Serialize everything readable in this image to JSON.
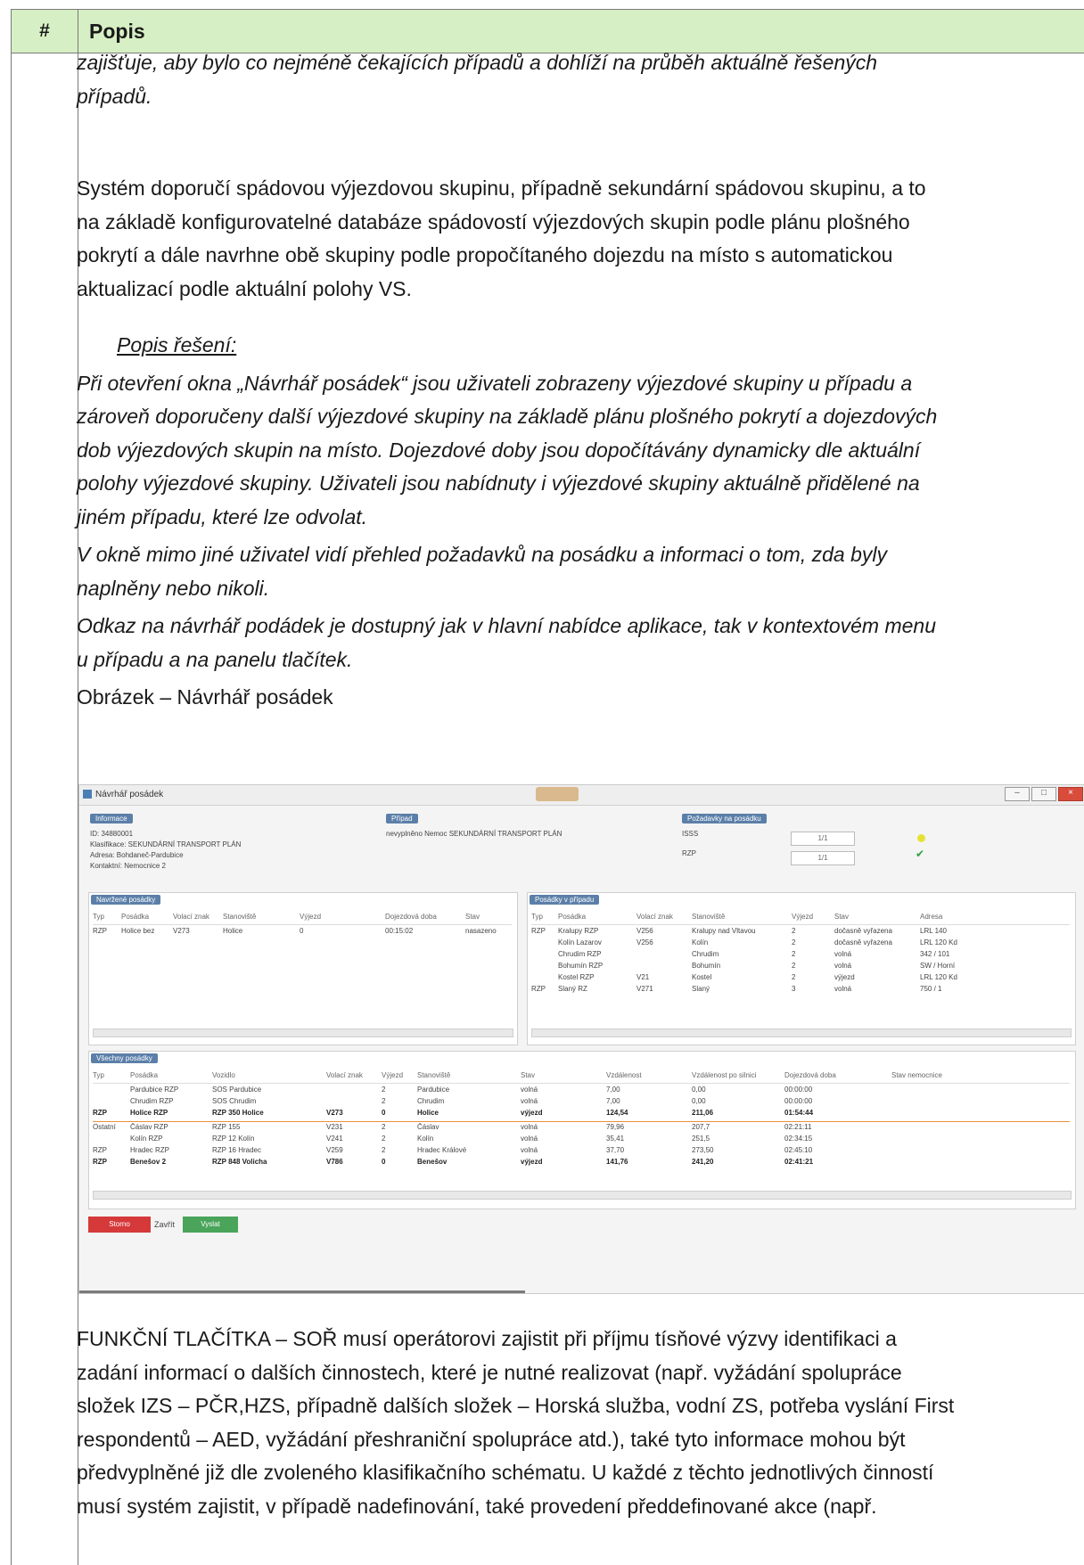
{
  "table": {
    "header_num": "#",
    "header_title": "Popis"
  },
  "paragraphs": {
    "p1_l1": "zajišťuje, aby bylo co nejméně čekajících případů a dohlíží na průběh aktuálně řešených",
    "p1_l2": "případů.",
    "p2_l1": "Systém doporučí spádovou výjezdovou skupinu, případně sekundární spádovou skupinu, a to",
    "p2_l2": "na základě konfigurovatelné databáze spádovostí výjezdových skupin podle plánu plošného",
    "p2_l3": "pokrytí a dále navrhne obě skupiny podle propočítaného dojezdu na místo s automatickou",
    "p2_l4": "aktualizací podle aktuální polohy VS.",
    "sub_heading": "Popis řešení:",
    "p3_l1": "Při otevření okna „Návrhář posádek“ jsou uživateli zobrazeny výjezdové skupiny u případu a",
    "p3_l2": "zároveň doporučeny další výjezdové skupiny na základě plánu plošného pokrytí a dojezdových",
    "p3_l3": "dob výjezdových skupin na místo. Dojezdové doby jsou dopočítávány dynamicky dle aktuální",
    "p3_l4": "polohy výjezdové skupiny. Uživateli jsou nabídnuty i výjezdové skupiny aktuálně přidělené na",
    "p3_l5": "jiném případu, které lze odvolat.",
    "p4_l1": "V okně mimo jiné uživatel vidí přehled požadavků na posádku a informaci o tom, zda byly",
    "p4_l2": "naplněny nebo nikoli.",
    "p5_l1": "Odkaz na návrhář podádek je dostupný jak v hlavní nabídce aplikace, tak v kontextovém menu",
    "p5_l2": "u případu a na panelu tlačítek.",
    "caption": "Obrázek – Návrhář posádek",
    "p6_l1": "FUNKČNÍ TLAČÍTKA – SOŘ musí operátorovi zajistit při příjmu tísňové výzvy identifikaci a",
    "p6_l2": "zadání informací o dalších činnostech, které je nutné realizovat (např. vyžádání spolupráce",
    "p6_l3": "složek IZS – PČR,HZS, případně dalších složek – Horská služba, vodní ZS, potřeba vyslání First",
    "p6_l4": "respondentů – AED, vyžádání přeshraniční spolupráce atd.), také tyto informace mohou být",
    "p6_l5": "předvyplněné již dle zvoleného klasifikačního schématu. U každé z těchto jednotlivých činností",
    "p6_l6": "musí systém zajistit, v případě nadefinování, také provedení předdefinované akce (např."
  },
  "screenshot": {
    "window_title": "Návrhář posádek",
    "case_badge": "Informace",
    "case_lines": [
      "ID: 34880001",
      "Klasifikace: SEKUNDÁRNÍ TRANSPORT PLÁN",
      "Adresa: Bohdaneč-Pardubice",
      "Kontaktní: Nemocnice 2"
    ],
    "event_badge": "Případ",
    "event_text": "nevyplněno Nemoc SEKUNDÁRNÍ TRANSPORT PLÁN",
    "req_badge": "Požadavky na posádku",
    "req_rows": [
      {
        "label": "ISSS",
        "value": "1/1"
      },
      {
        "label": "RZP",
        "value": "1/1"
      }
    ],
    "assigned_badge": "Navržené posádky",
    "assigned_cols": [
      "Typ",
      "Posádka",
      "Volací znak",
      "Stanoviště",
      "Výjezd",
      "Dojezdová doba",
      "Stav"
    ],
    "assigned_rows": [
      [
        "RZP",
        "Holice bez",
        "V273",
        "Holice",
        "0",
        "00:15:02",
        "nasazeno"
      ]
    ],
    "others_badge": "Posádky v případu",
    "others_cols": [
      "Typ",
      "Posádka",
      "Volací znak",
      "Stanoviště",
      "Výjezd",
      "Stav",
      "Adresa"
    ],
    "others_rows": [
      [
        "RZP",
        "Kralupy RZP",
        "V256",
        "Kralupy nad Vltavou",
        "2",
        "dočasně vyřazena",
        "LRL 140"
      ],
      [
        "",
        "Kolín Lazarov",
        "V256",
        "Kolín",
        "2",
        "dočasně vyřazena",
        "LRL 120 Kd"
      ],
      [
        "",
        "Chrudim RZP",
        "",
        "Chrudim",
        "2",
        "volná",
        "342 / 101"
      ],
      [
        "",
        "Bohumín RZP",
        "",
        "Bohumín",
        "2",
        "volná",
        "SW / Horní"
      ],
      [
        "",
        "Kostel RZP",
        "V21",
        "Kostel",
        "2",
        "výjezd",
        "LRL 120 Kd"
      ],
      [
        "RZP",
        "Slaný RZ",
        "V271",
        "Slaný",
        "3",
        "volná",
        "750 / 1"
      ]
    ],
    "all_badge": "Všechny posádky",
    "all_cols": [
      "Typ",
      "Posádka",
      "Vozidlo",
      "Volací znak",
      "Výjezd",
      "Stanoviště",
      "Stav",
      "Vzdálenost",
      "Vzdálenost po silnici",
      "Dojezdová doba",
      "Stav nemocnice"
    ],
    "all_rows": [
      {
        "b": false,
        "c": [
          "",
          "Pardubice RZP",
          "SOS Pardubice",
          "",
          "2",
          "Pardubice",
          "volná",
          "7,00",
          "0,00",
          "00:00:00",
          ""
        ]
      },
      {
        "b": false,
        "c": [
          "",
          "Chrudim RZP",
          "SOS Chrudim",
          "",
          "2",
          "Chrudim",
          "volná",
          "7,00",
          "0,00",
          "00:00:00",
          ""
        ]
      },
      {
        "b": true,
        "c": [
          "RZP",
          "Holice RZP",
          "RZP 350 Holice",
          "V273",
          "0",
          "Holice",
          "výjezd",
          "124,54",
          "211,06",
          "01:54:44",
          ""
        ]
      },
      {
        "b": false,
        "c": [
          "Ostatní",
          "Čáslav RZP",
          "RZP 155",
          "V231",
          "2",
          "Čáslav",
          "volná",
          "79,96",
          "207,7",
          "02:21:11",
          ""
        ]
      },
      {
        "b": false,
        "c": [
          "",
          "Kolín RZP",
          "RZP 12 Kolín",
          "V241",
          "2",
          "Kolín",
          "volná",
          "35,41",
          "251,5",
          "02:34:15",
          ""
        ]
      },
      {
        "b": false,
        "c": [
          "RZP",
          "Hradec RZP",
          "RZP 16 Hradec",
          "V259",
          "2",
          "Hradec Králové",
          "volná",
          "37,70",
          "273,50",
          "02:45:10",
          ""
        ]
      },
      {
        "b": true,
        "c": [
          "RZP",
          "Benešov 2",
          "RZP 848 Volicha",
          "V786",
          "0",
          "Benešov",
          "výjezd",
          "141,76",
          "241,20",
          "02:41:21",
          ""
        ]
      }
    ],
    "btn_cancel": "Storno",
    "btn_close": "Zavřít",
    "btn_ok": "Vyslat",
    "colors": {
      "cancel": "#d6393a",
      "ok": "#4aa45a",
      "badge": "#5b7fa8",
      "header_bg": "#d7efc4"
    }
  }
}
